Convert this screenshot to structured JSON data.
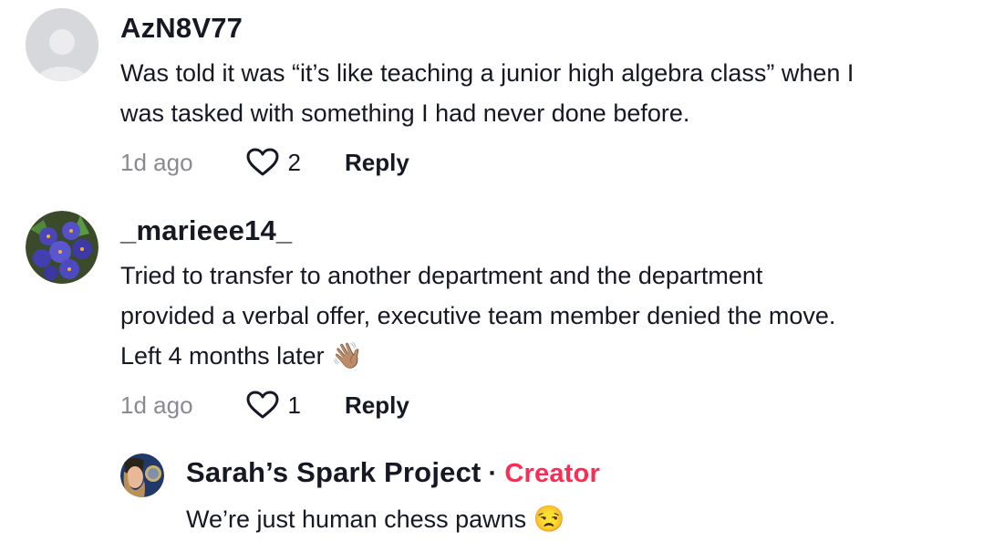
{
  "comments": [
    {
      "username": "AzN8V77",
      "avatar": "default-avatar",
      "lines": [
        "Was told it was “it’s like teaching a junior high algebra class” when I",
        "was tasked with something I had never done before."
      ],
      "time": "1d ago",
      "likes": "2",
      "reply_label": "Reply"
    },
    {
      "username": "_marieee14_",
      "avatar": "flowers-avatar",
      "lines": [
        "Tried to transfer to another department and the department",
        "provided a verbal offer, executive team member denied the move.",
        "Left 4 months later"
      ],
      "emoji": "👋🏽",
      "time": "1d ago",
      "likes": "1",
      "reply_label": "Reply"
    }
  ],
  "reply": {
    "username": "Sarah’s Spark Project",
    "separator": "·",
    "badge": "Creator",
    "text": "We’re just human chess pawns",
    "emoji": "😒"
  },
  "colors": {
    "text": "#161823",
    "muted": "#8a8b91",
    "creator": "#fe2c55"
  }
}
